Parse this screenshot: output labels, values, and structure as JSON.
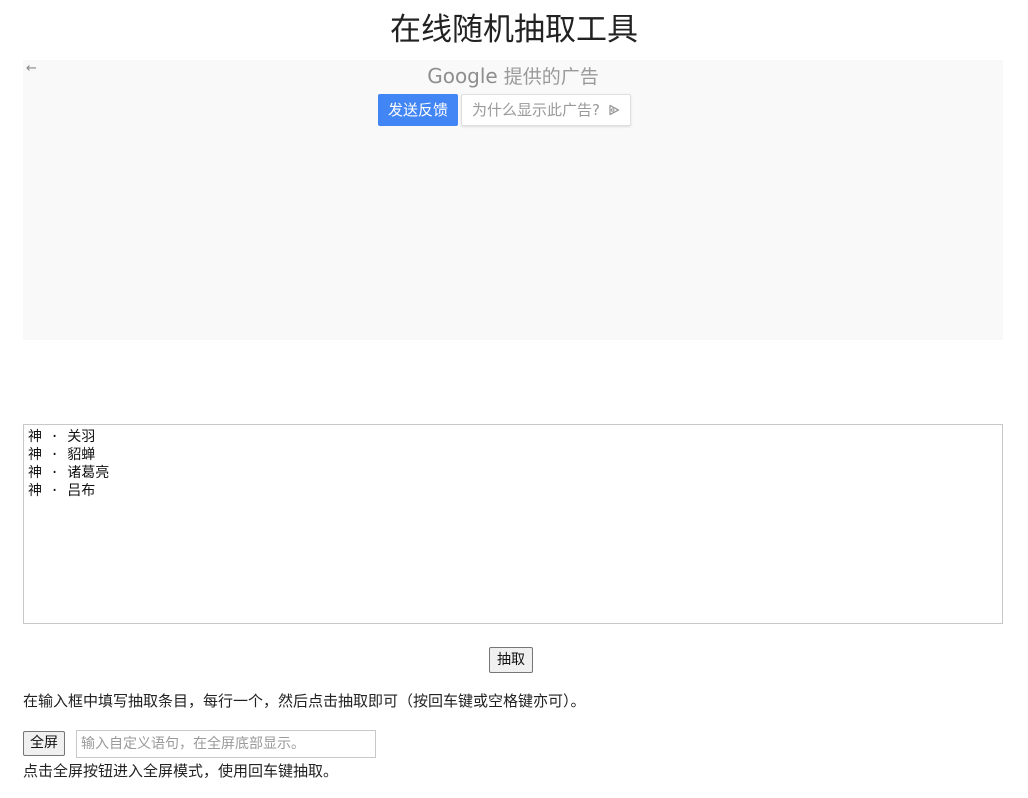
{
  "page": {
    "title": "在线随机抽取工具"
  },
  "ad": {
    "back_icon": "arrow-left-icon",
    "google_label": "Google",
    "provided_label": "提供的广告",
    "feedback_button": "发送反馈",
    "why_button": "为什么显示此广告?",
    "why_icon": "adchoices-play-icon",
    "feedback_color": "#4285f4"
  },
  "entries": {
    "value": "神 · 关羽\n神 · 貂蝉\n神 · 诸葛亮\n神 · 吕布"
  },
  "draw_button": {
    "label": "抽取"
  },
  "instruction": {
    "text": "在输入框中填写抽取条目，每行一个，然后点击抽取即可（按回车键或空格键亦可）。"
  },
  "fullscreen": {
    "button_label": "全屏",
    "input_placeholder": "输入自定义语句，在全屏底部显示。",
    "input_value": "",
    "hint": "点击全屏按钮进入全屏模式，使用回车键抽取。"
  }
}
